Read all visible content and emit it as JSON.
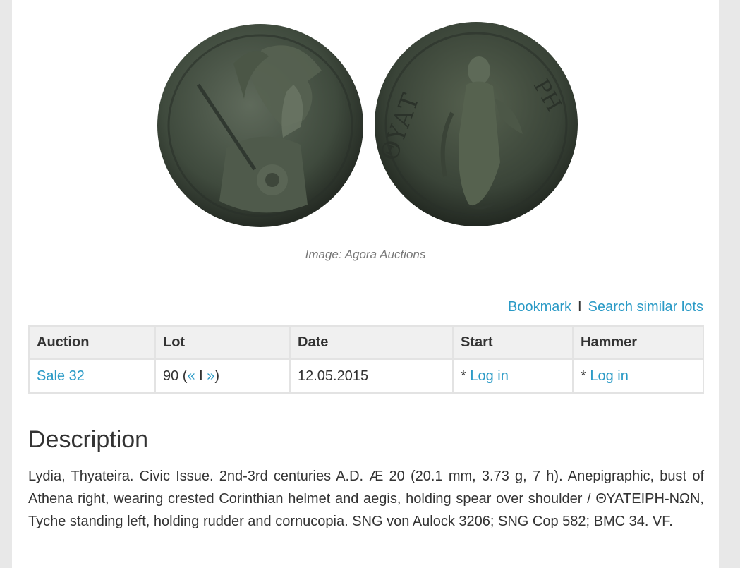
{
  "image": {
    "caption": "Image: Agora Auctions",
    "colors": {
      "coin_dark": "#2c322b",
      "coin_mid": "#4a5547",
      "coin_light": "#6d7868"
    }
  },
  "actions": {
    "bookmark": "Bookmark",
    "separator": "I",
    "search_similar": "Search similar lots"
  },
  "table": {
    "headers": {
      "auction": "Auction",
      "lot": "Lot",
      "date": "Date",
      "start": "Start",
      "hammer": "Hammer"
    },
    "row": {
      "auction": "Sale 32",
      "lot_number": "90",
      "prev": "«",
      "nav_sep": "I",
      "next": "»",
      "date": "12.05.2015",
      "start_prefix": "*",
      "start_link": "Log in",
      "hammer_prefix": "*",
      "hammer_link": "Log in"
    }
  },
  "description": {
    "heading": "Description",
    "text": "Lydia, Thyateira. Civic Issue. 2nd-3rd centuries A.D. Æ 20 (20.1 mm, 3.73 g, 7 h). Anepigraphic, bust of Athena right, wearing crested Corinthian helmet and aegis, holding spear over shoulder / ΘΥΑΤΕΙΡΗ-ΝΩΝ, Tyche standing left, holding rudder and cornucopia. SNG von Aulock 3206; SNG Cop 582; BMC 34. VF."
  },
  "link_color": "#2a9ac6"
}
